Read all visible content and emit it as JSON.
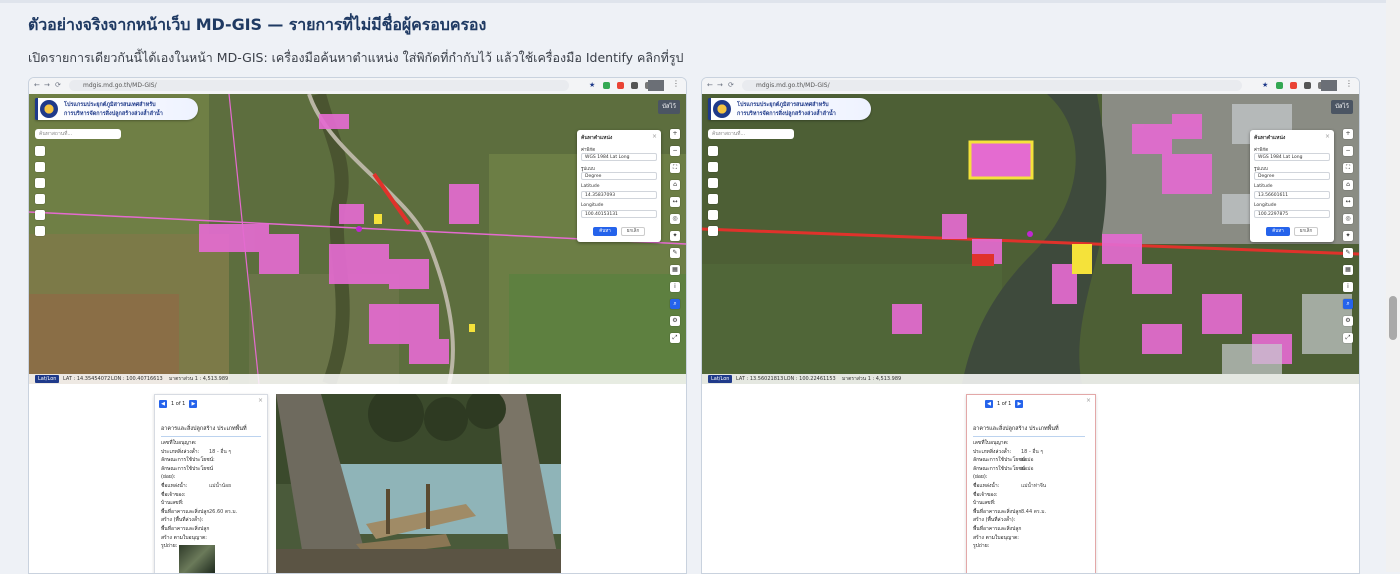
{
  "heading": "ตัวอย่างจริงจากหน้าเว็บ MD-GIS — รายการที่ไม่มีชื่อผู้ครอบครอง",
  "description": "เปิดรายการเดียวกันนี้ได้เองในหน้า MD-GIS: เครื่องมือค้นหาตำแหน่ง ใส่พิกัดที่กำกับไว้ แล้วใช้เครื่องมือ Identify คลิกที่รูป",
  "browser": {
    "url": "mdgis.md.go.th/MD-GIS/"
  },
  "banner": {
    "line1": "โปรแกรมประยุกต์ภูมิสารสนเทศสำหรับ",
    "line2": "การบริหารจัดการสิ่งปลูกสร้างล่วงล้ำลำน้ำ"
  },
  "layer_button": "บัสไว้",
  "map_search_placeholder": "ค้นหาสถานที่...",
  "coord_panel": {
    "title": "ค้นหาตำแหน่ง",
    "type_label": "ค่าพิกัด",
    "type_value": "WGS 1984 Lat Long",
    "format_label": "รูปแบบ",
    "format_value": "Degree",
    "lat_label": "Latitude",
    "lon_label": "Longitude",
    "ok_label": "ค้นหา",
    "cancel_label": "ยกเลิก"
  },
  "screens": [
    {
      "lat_value": "14.35837093",
      "lon_value": "100.40153131",
      "status": {
        "tag": "Lat/Lon",
        "lat": "LAT : 14.35454072",
        "lon": "LON : 100.40716613",
        "scale": "มาตราส่วน 1 : 4,513.989"
      },
      "identify": {
        "pager": "1 of 1",
        "title": "อาคารและสิ่งปลูกสร้าง ประเภทพื้นที่",
        "rows": [
          {
            "k": "เลขที่ใบอนุญาต:",
            "v": ""
          },
          {
            "k": "ประเภทสิ่งล่วงล้ำ:",
            "v": "18 - อื่น ๆ"
          },
          {
            "k": "ลักษณะการใช้ประโยชน์:",
            "v": ""
          },
          {
            "k": "ลักษณะการใช้ประโยชน์",
            "v": ""
          },
          {
            "k": "(ย่อย):",
            "v": ""
          },
          {
            "k": "ชื่อแหล่งน้ำ:",
            "v": "แม่น้ำน้อย"
          },
          {
            "k": "ชื่อเจ้าของ:",
            "v": ""
          },
          {
            "k": "บ้านเลขที่:",
            "v": ""
          },
          {
            "k": "พื้นที่อาคารและสิ่งปลูก",
            "v": "26.60 ตร.ม."
          },
          {
            "k": "สร้าง (พื้นที่ล่วงล้ำ):",
            "v": ""
          },
          {
            "k": "พื้นที่อาคารและสิ่งปลูก",
            "v": ""
          },
          {
            "k": "สร้าง ตามใบอนุญาต:",
            "v": ""
          },
          {
            "k": "รูปถ่าย:",
            "v": ""
          }
        ]
      }
    },
    {
      "lat_value": "13.56601611",
      "lon_value": "100.2297875",
      "status": {
        "tag": "Lat/Lon",
        "lat": "LAT : 13.56021813",
        "lon": "LON : 100.22461153",
        "scale": "มาตราส่วน 1 : 4,513.989"
      },
      "identify": {
        "pager": "1 of 1",
        "title": "อาคารและสิ่งปลูกสร้าง ประเภทพื้นที่",
        "rows": [
          {
            "k": "เลขที่ใบอนุญาต:",
            "v": ""
          },
          {
            "k": "ประเภทสิ่งล่วงล้ำ:",
            "v": "18 - อื่น ๆ"
          },
          {
            "k": "ลักษณะการใช้ประโยชน์:",
            "v": "ตอม่อ"
          },
          {
            "k": "ลักษณะการใช้ประโยชน์",
            "v": "ตอม่อ"
          },
          {
            "k": "(ย่อย):",
            "v": ""
          },
          {
            "k": "ชื่อแหล่งน้ำ:",
            "v": "แม่น้ำท่าจีน"
          },
          {
            "k": "ชื่อเจ้าของ:",
            "v": ""
          },
          {
            "k": "บ้านเลขที่:",
            "v": ""
          },
          {
            "k": "พื้นที่อาคารและสิ่งปลูก",
            "v": "8.44 ตร.ม."
          },
          {
            "k": "สร้าง (พื้นที่ล่วงล้ำ):",
            "v": ""
          },
          {
            "k": "พื้นที่อาคารและสิ่งปลูก",
            "v": ""
          },
          {
            "k": "สร้าง ตามใบอนุญาต:",
            "v": ""
          },
          {
            "k": "รูปถ่าย:",
            "v": ""
          }
        ]
      }
    }
  ],
  "colors": {
    "heading": "#1f3a63",
    "accent": "#2563eb",
    "overlay": "#e46bd0"
  }
}
